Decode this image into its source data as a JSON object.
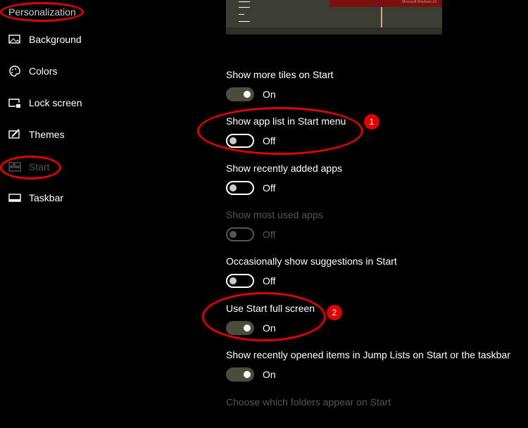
{
  "sidebar": {
    "title": "Personalization",
    "items": [
      {
        "label": "Background",
        "icon": "picture-icon"
      },
      {
        "label": "Colors",
        "icon": "palette-icon"
      },
      {
        "label": "Lock screen",
        "icon": "lock-screen-icon"
      },
      {
        "label": "Themes",
        "icon": "themes-icon"
      },
      {
        "label": "Start",
        "icon": "start-icon",
        "selected": true
      },
      {
        "label": "Taskbar",
        "icon": "taskbar-icon"
      }
    ]
  },
  "preview": {
    "caption": "Microsoft Windows 10"
  },
  "settings": [
    {
      "label": "Show more tiles on Start",
      "state": "On"
    },
    {
      "label": "Show app list in Start menu",
      "state": "Off"
    },
    {
      "label": "Show recently added apps",
      "state": "Off"
    },
    {
      "label": "Show most used apps",
      "state": "Off",
      "disabled": true
    },
    {
      "label": "Occasionally show suggestions in Start",
      "state": "Off"
    },
    {
      "label": "Use Start full screen",
      "state": "On"
    },
    {
      "label": "Show recently opened items in Jump Lists on Start or the taskbar",
      "state": "On"
    }
  ],
  "folders_link": "Choose which folders appear on Start",
  "annotations": {
    "badge1": "1",
    "badge2": "2",
    "color": "#e00000"
  }
}
